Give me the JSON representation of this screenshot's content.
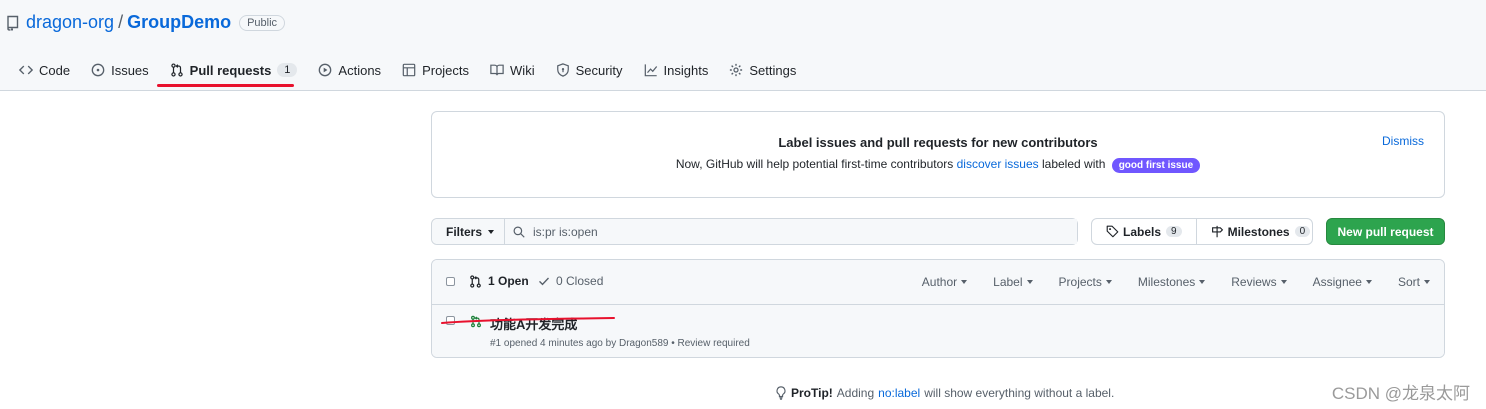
{
  "repo": {
    "owner": "dragon-org",
    "separator": "/",
    "name": "GroupDemo",
    "visibility": "Public"
  },
  "tabs": [
    {
      "label": "Code",
      "icon": "code-icon"
    },
    {
      "label": "Issues",
      "icon": "issue-opened-icon"
    },
    {
      "label": "Pull requests",
      "icon": "git-pull-request-icon",
      "counter": "1",
      "selected": true
    },
    {
      "label": "Actions",
      "icon": "play-icon"
    },
    {
      "label": "Projects",
      "icon": "table-icon"
    },
    {
      "label": "Wiki",
      "icon": "book-icon"
    },
    {
      "label": "Security",
      "icon": "shield-icon"
    },
    {
      "label": "Insights",
      "icon": "graph-icon"
    },
    {
      "label": "Settings",
      "icon": "gear-icon"
    }
  ],
  "banner": {
    "title": "Label issues and pull requests for new contributors",
    "text_before": "Now, GitHub will help potential first-time contributors ",
    "link": "discover issues",
    "text_after": " labeled with ",
    "label": "good first issue",
    "dismiss": "Dismiss"
  },
  "filters": {
    "button": "Filters",
    "query": "is:pr is:open"
  },
  "labels_button": {
    "label": "Labels",
    "count": "9"
  },
  "milestones_button": {
    "label": "Milestones",
    "count": "0"
  },
  "new_pr_button": "New pull request",
  "list": {
    "open": "1 Open",
    "closed": "0 Closed",
    "sort_menus": [
      "Author",
      "Label",
      "Projects",
      "Milestones",
      "Reviews",
      "Assignee",
      "Sort"
    ]
  },
  "pull_requests": [
    {
      "title": "功能A开发完成",
      "meta": "#1 opened 4 minutes ago by Dragon589 • Review required"
    }
  ],
  "protip": {
    "lead": "ProTip!",
    "before": "Adding",
    "link": "no:label",
    "after": "will show everything without a label."
  },
  "watermark": "CSDN @龙泉太阿",
  "colors": {
    "accent": "#0969da",
    "primary_button": "#2da44e",
    "label_good_first_issue": "#7057ff",
    "annotation_red": "#e8112d",
    "pr_open_green": "#1a7f37"
  }
}
